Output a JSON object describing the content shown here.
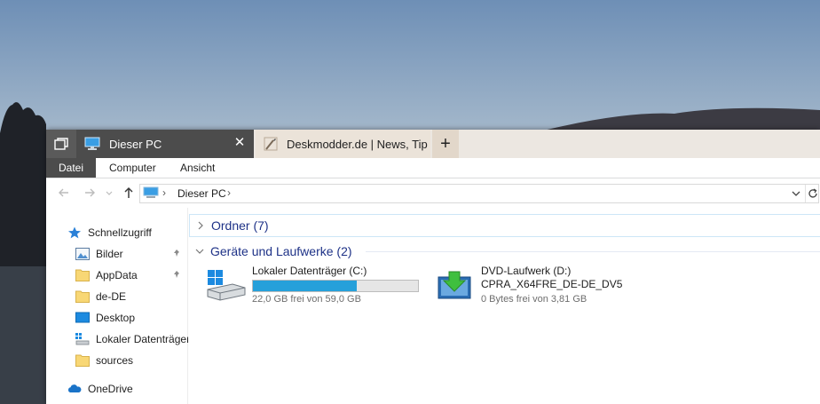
{
  "tabs": [
    {
      "label": "Dieser PC",
      "active": true
    },
    {
      "label": "Deskmodder.de | News, Tip",
      "active": false
    }
  ],
  "tab_close": "✕",
  "new_tab": "+",
  "ribbon": {
    "file": "Datei",
    "computer": "Computer",
    "view": "Ansicht"
  },
  "address": {
    "crumb": "Dieser PC",
    "sep": "›"
  },
  "nav": {
    "items": [
      {
        "label": "Schnellzugriff",
        "icon": "star-icon"
      },
      {
        "label": "Bilder",
        "icon": "pictures-icon",
        "pinned": true
      },
      {
        "label": "AppData",
        "icon": "folder-icon",
        "pinned": true
      },
      {
        "label": "de-DE",
        "icon": "folder-icon"
      },
      {
        "label": "Desktop",
        "icon": "desktop-icon"
      },
      {
        "label": "Lokaler Datenträger",
        "icon": "drive-icon"
      },
      {
        "label": "sources",
        "icon": "folder-icon"
      },
      {
        "label": "OneDrive",
        "icon": "cloud-icon"
      }
    ]
  },
  "content": {
    "folders_group": "Ordner (7)",
    "drives_group": "Geräte und Laufwerke (2)",
    "drives": [
      {
        "name": "Lokaler Datenträger (C:)",
        "free": "22,0 GB frei von 59,0 GB",
        "used_fraction": 0.63
      },
      {
        "name": "DVD-Laufwerk (D:)",
        "label": "CPRA_X64FRE_DE-DE_DV5",
        "free": "0 Bytes frei von 3,81 GB"
      }
    ]
  },
  "colors": {
    "accent": "#26a0da",
    "group_header": "#1e3287",
    "tab_active": "#4c4c4c"
  }
}
